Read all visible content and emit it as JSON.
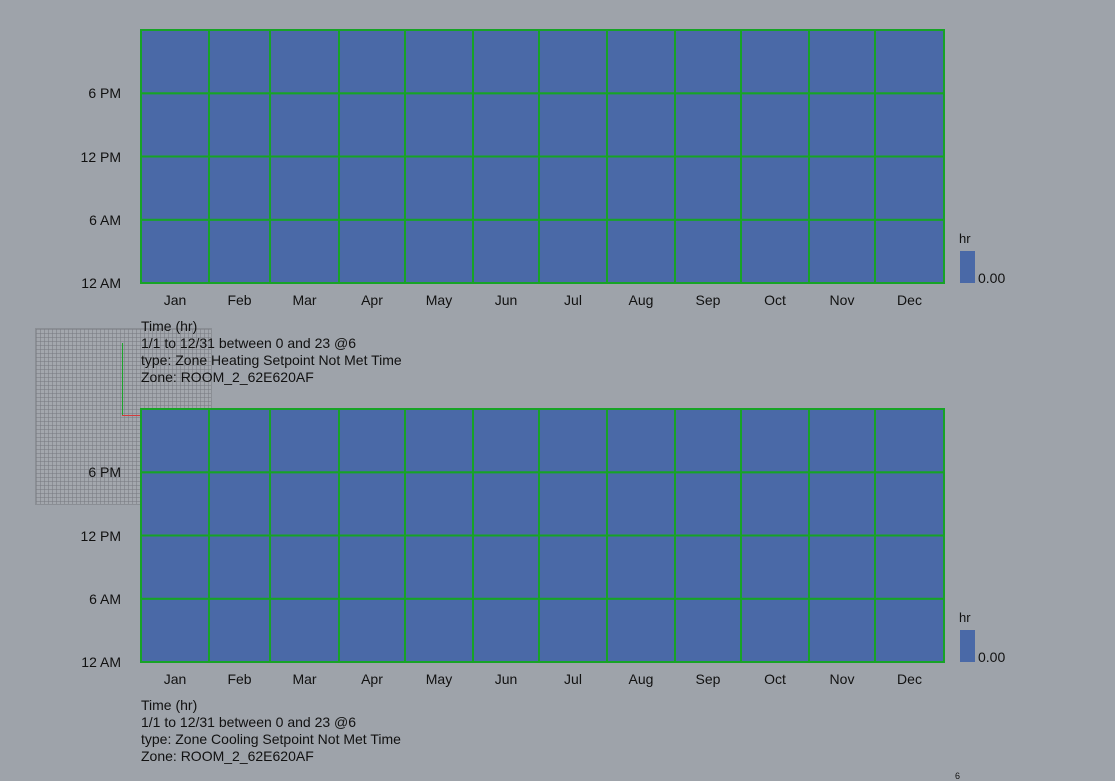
{
  "chart_data": [
    {
      "type": "heatmap",
      "categories": [
        "Jan",
        "Feb",
        "Mar",
        "Apr",
        "May",
        "Jun",
        "Jul",
        "Aug",
        "Sep",
        "Oct",
        "Nov",
        "Dec"
      ],
      "ytick_labels": [
        "12 AM",
        "6 AM",
        "12 PM",
        "6 PM"
      ],
      "values": [
        [
          0,
          0,
          0,
          0,
          0,
          0,
          0,
          0,
          0,
          0,
          0,
          0
        ],
        [
          0,
          0,
          0,
          0,
          0,
          0,
          0,
          0,
          0,
          0,
          0,
          0
        ],
        [
          0,
          0,
          0,
          0,
          0,
          0,
          0,
          0,
          0,
          0,
          0,
          0
        ],
        [
          0,
          0,
          0,
          0,
          0,
          0,
          0,
          0,
          0,
          0,
          0,
          0
        ]
      ],
      "caption": [
        "Time (hr)",
        "1/1 to 12/31 between 0 and 23 @6",
        "type: Zone Heating Setpoint Not Met Time",
        "Zone: ROOM_2_62E620AF"
      ],
      "legend": {
        "unit": "hr",
        "value": "0.00"
      },
      "cell_color": "#4a69a7",
      "grid_color": "#17a326"
    },
    {
      "type": "heatmap",
      "categories": [
        "Jan",
        "Feb",
        "Mar",
        "Apr",
        "May",
        "Jun",
        "Jul",
        "Aug",
        "Sep",
        "Oct",
        "Nov",
        "Dec"
      ],
      "ytick_labels": [
        "12 AM",
        "6 AM",
        "12 PM",
        "6 PM"
      ],
      "values": [
        [
          0,
          0,
          0,
          0,
          0,
          0,
          0,
          0,
          0,
          0,
          0,
          0
        ],
        [
          0,
          0,
          0,
          0,
          0,
          0,
          0,
          0,
          0,
          0,
          0,
          0
        ],
        [
          0,
          0,
          0,
          0,
          0,
          0,
          0,
          0,
          0,
          0,
          0,
          0
        ],
        [
          0,
          0,
          0,
          0,
          0,
          0,
          0,
          0,
          0,
          0,
          0,
          0
        ]
      ],
      "caption": [
        "Time (hr)",
        "1/1 to 12/31 between 0 and 23 @6",
        "type: Zone Cooling Setpoint Not Met Time",
        "Zone: ROOM_2_62E620AF"
      ],
      "legend": {
        "unit": "hr",
        "value": "0.00"
      },
      "cell_color": "#4a69a7",
      "grid_color": "#17a326"
    }
  ],
  "corner_glyph": "6"
}
